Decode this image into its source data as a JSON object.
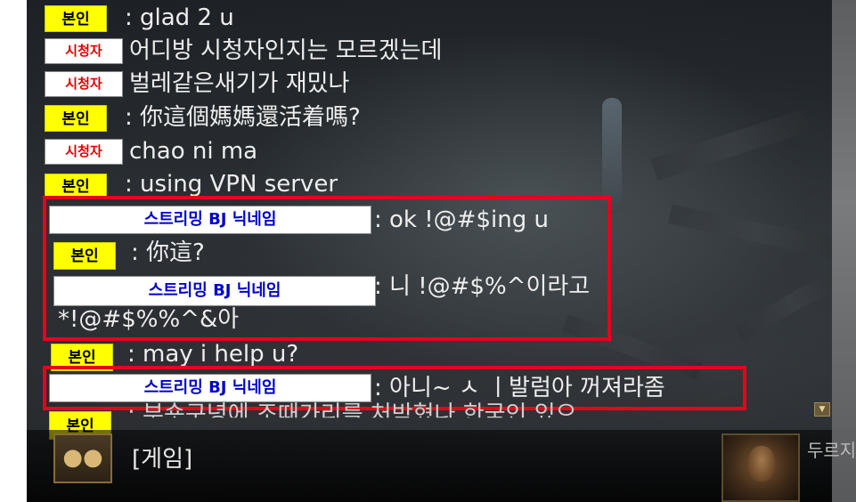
{
  "tags": {
    "self": "본인",
    "viewer": "시청자",
    "bj": "스트리밍 BJ 닉네임"
  },
  "messages": [
    {
      "text": ": glad 2 u"
    },
    {
      "text": "어디방 시청자인지는 모르겠는데"
    },
    {
      "text": "벌레같은새기가 재밌나"
    },
    {
      "text": ": 你這個媽媽還活着嗎?"
    },
    {
      "text": "chao ni ma"
    },
    {
      "text": ": using VPN server"
    },
    {
      "text": ": ok !@#$ing u"
    },
    {
      "text": ": 你這?"
    },
    {
      "text": ": 니 !@#$%^이라고"
    },
    {
      "text": "*!@#$%%^&아"
    },
    {
      "text": ": may i help u?"
    },
    {
      "text": ": 아니~ ㅅ ㅣ발럼아 꺼져라좀"
    },
    {
      "text": ": 부숏구녕에 조때가리를 처박혔나 한국인 있으"
    }
  ],
  "input": {
    "value": "[게임]"
  },
  "side": {
    "label": "두르지"
  },
  "icons": {
    "party": "party-icon",
    "portrait": "character-portrait",
    "scroll": "scroll-down-icon"
  },
  "colors": {
    "highlight_box": "#e8001c",
    "self_tag": "#ffff00",
    "viewer_text": "#e00000",
    "bj_text": "#0000c8"
  }
}
